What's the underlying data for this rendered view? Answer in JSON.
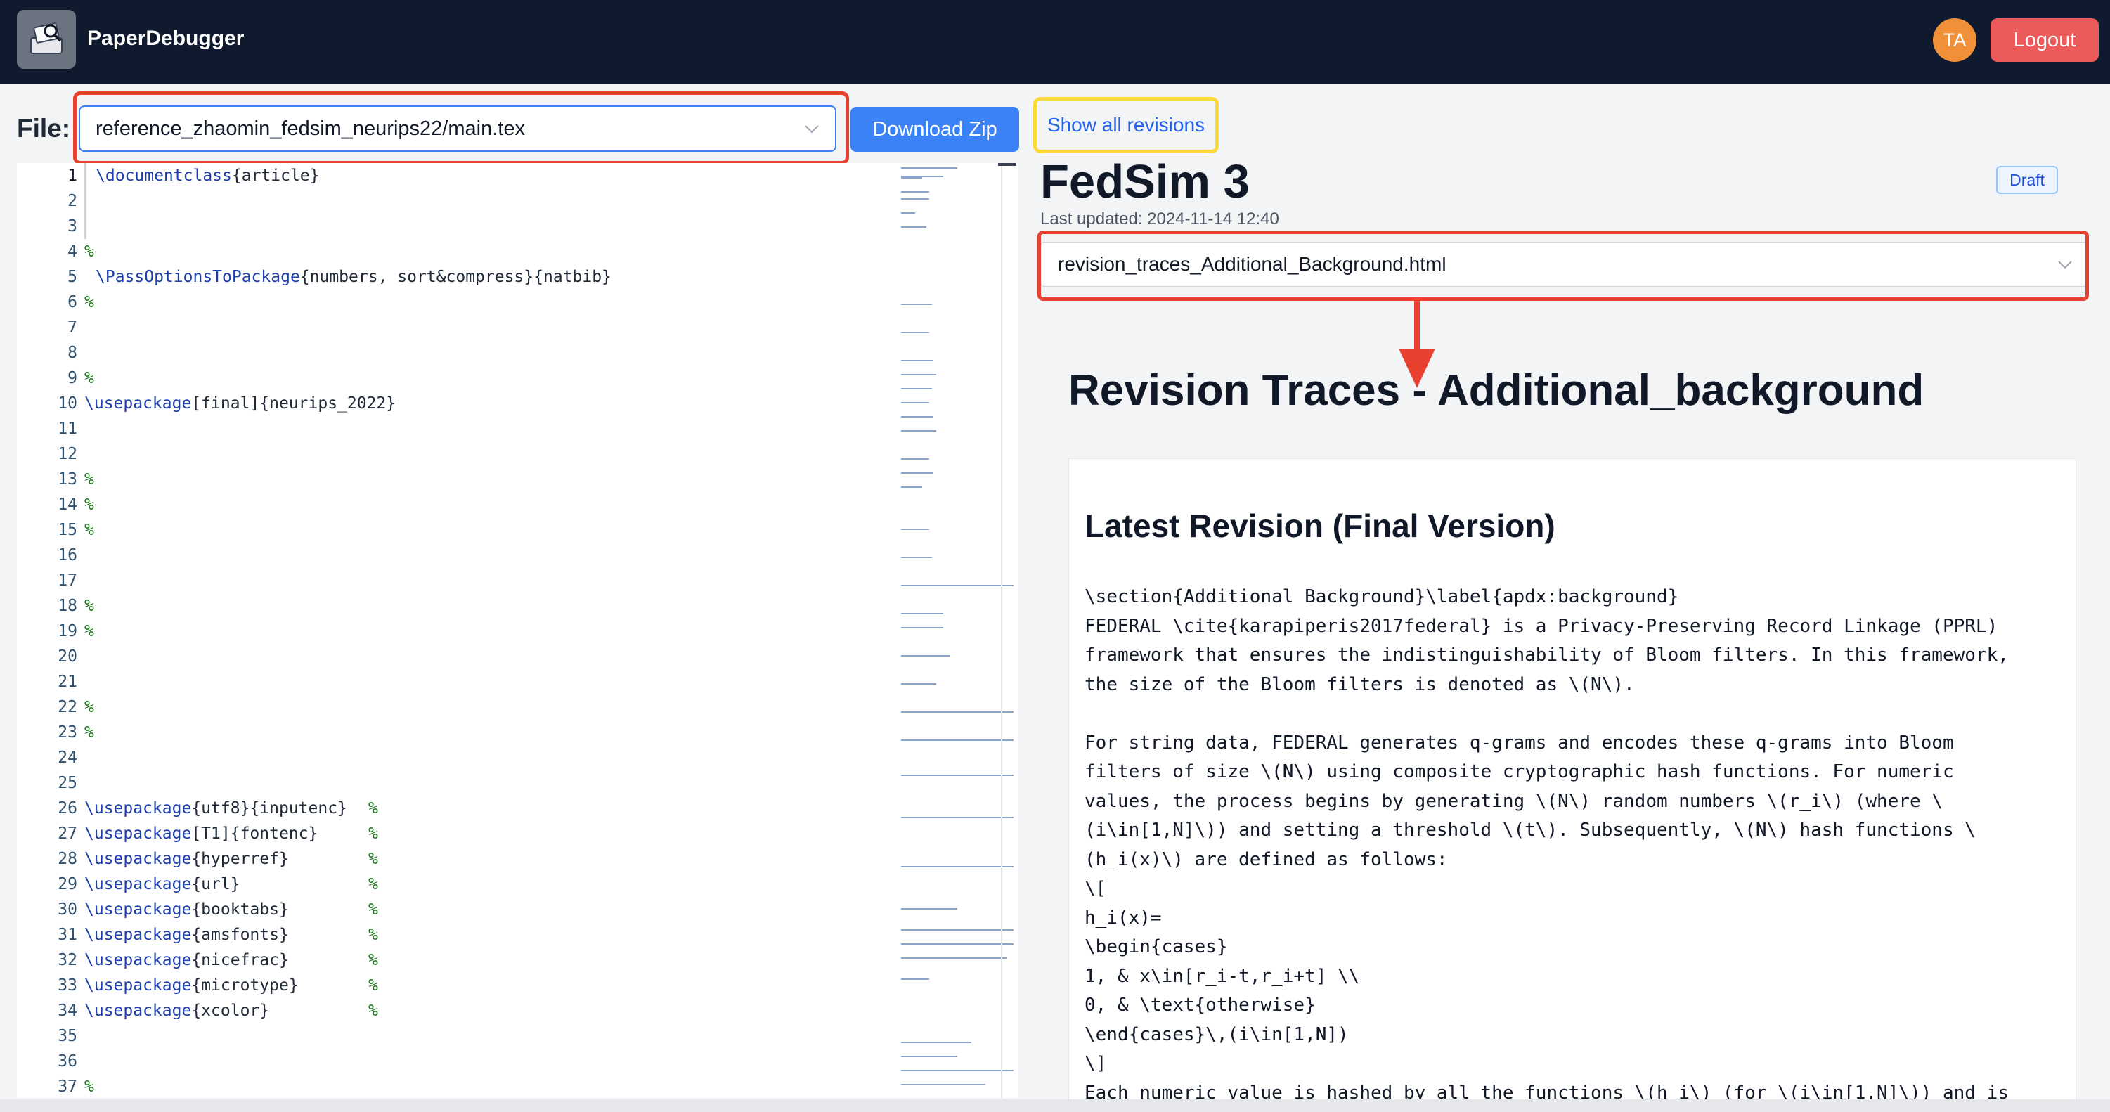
{
  "app": {
    "title": "PaperDebugger",
    "avatar_initials": "TA",
    "logout_label": "Logout"
  },
  "colors": {
    "header_bg": "#0f1a2e",
    "primary": "#3b82f6",
    "logout": "#ec5a5a",
    "avatar": "#f0913a",
    "highlight_red": "#e8412f",
    "highlight_yellow": "#fad939"
  },
  "file_bar": {
    "label": "File:",
    "selected_file": "reference_zhaomin_fedsim_neurips22/main.tex",
    "download_label": "Download Zip",
    "show_revisions_label": "Show all revisions"
  },
  "editor": {
    "line_numbers": [
      "1",
      "2",
      "3",
      "4",
      "5",
      "6",
      "7",
      "8",
      "9",
      "10",
      "11",
      "12",
      "13",
      "14",
      "15",
      "16",
      "17",
      "18",
      "19",
      "20",
      "21",
      "22",
      "23",
      "24",
      "25",
      "26",
      "27",
      "28",
      "29",
      "30",
      "31",
      "32",
      "33",
      "34",
      "35",
      "36",
      "37"
    ],
    "lines": {
      "l1_cmd": "\\documentclass",
      "l1_arg": "{article}",
      "l5_cmd": "\\PassOptionsToPackage",
      "l5_arg": "{numbers, sort&compress}{natbib}",
      "l10_cmd": "\\usepackage",
      "l10_arg": "[final]{neurips_2022}",
      "l26_arg": "{utf8}{inputenc}",
      "l27_arg": "[T1]{fontenc}",
      "l28_arg": "{hyperref}",
      "l29_arg": "{url}",
      "l30_arg": "{booktabs}",
      "l31_arg": "{amsfonts}",
      "l32_arg": "{nicefrac}",
      "l33_arg": "{microtype}",
      "l34_arg": "{xcolor}",
      "usepackage": "\\usepackage",
      "comment": "%"
    }
  },
  "document": {
    "title": "FedSim 3",
    "last_updated": "Last updated: 2024-11-14 12:40",
    "status_badge": "Draft",
    "selected_revision": "revision_traces_Additional_Background.html",
    "revision_heading": "Revision Traces - Additional_background",
    "latest_title": "Latest Revision (Final Version)",
    "body": "\\section{Additional Background}\\label{apdx:background}\nFEDERAL \\cite{karapiperis2017federal} is a Privacy-Preserving Record Linkage (PPRL)\nframework that ensures the indistinguishability of Bloom filters. In this framework,\nthe size of the Bloom filters is denoted as \\(N\\).\n\nFor string data, FEDERAL generates q-grams and encodes these q-grams into Bloom\nfilters of size \\(N\\) using composite cryptographic hash functions. For numeric\nvalues, the process begins by generating \\(N\\) random numbers \\(r_i\\) (where \\\n(i\\in[1,N]\\)) and setting a threshold \\(t\\). Subsequently, \\(N\\) hash functions \\\n(h_i(x)\\) are defined as follows:\n\\[\nh_i(x)=\n\\begin{cases}\n1, & x\\in[r_i-t,r_i+t] \\\\\n0, & \\text{otherwise}\n\\end{cases}\\,(i\\in[1,N])\n\\]\nEach numeric value is hashed by all the functions \\(h_i\\) (for \\(i\\in[1,N]\\)) and is"
  }
}
